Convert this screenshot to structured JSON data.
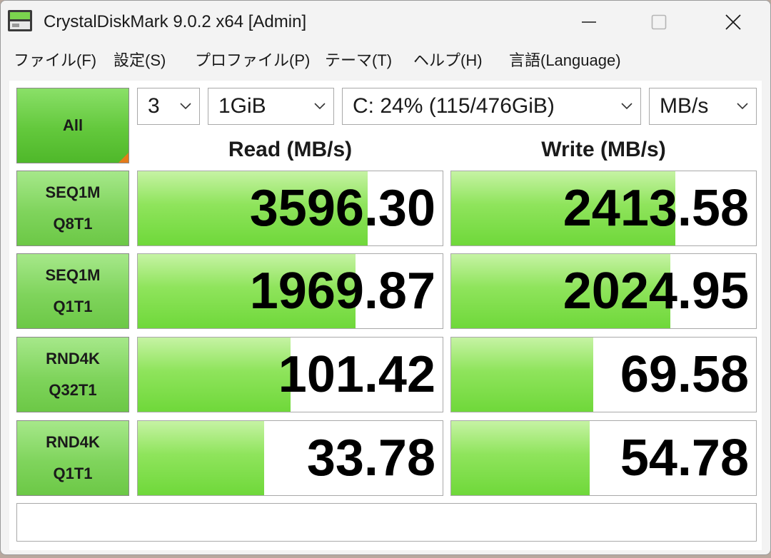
{
  "window": {
    "title": "CrystalDiskMark 9.0.2 x64 [Admin]",
    "app_icon": "disk-icon"
  },
  "menu": [
    {
      "label": "ファイル(F)"
    },
    {
      "label": "設定(S)"
    },
    {
      "label": "プロファイル(P)"
    },
    {
      "label": "テーマ(T)"
    },
    {
      "label": "ヘルプ(H)"
    },
    {
      "label": "言語(Language)"
    }
  ],
  "controls": {
    "all_label": "All",
    "count": "3",
    "size": "1GiB",
    "drive": "C: 24% (115/476GiB)",
    "unit": "MB/s"
  },
  "headers": {
    "read": "Read (MB/s)",
    "write": "Write (MB/s)"
  },
  "results": [
    {
      "line1": "SEQ1M",
      "line2": "Q8T1",
      "read": "3596.30",
      "write": "2413.58",
      "read_fill": 0.755,
      "write_fill": 0.735
    },
    {
      "line1": "SEQ1M",
      "line2": "Q1T1",
      "read": "1969.87",
      "write": "2024.95",
      "read_fill": 0.715,
      "write_fill": 0.72
    },
    {
      "line1": "RND4K",
      "line2": "Q32T1",
      "read": "101.42",
      "write": "69.58",
      "read_fill": 0.5,
      "write_fill": 0.465
    },
    {
      "line1": "RND4K",
      "line2": "Q1T1",
      "read": "33.78",
      "write": "54.78",
      "read_fill": 0.415,
      "write_fill": 0.455
    }
  ],
  "status": "",
  "colors": {
    "bar_green": "#6fd83a",
    "button_green": "#63c83c",
    "corner_orange": "#e47b1a"
  }
}
